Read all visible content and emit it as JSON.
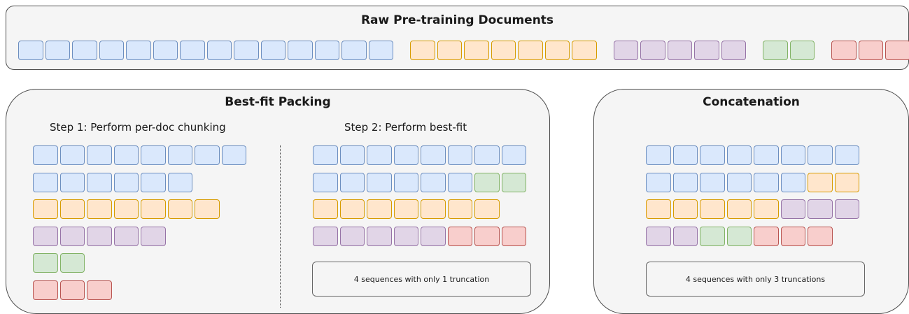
{
  "top": {
    "title": "Raw Pre-training Documents"
  },
  "packing": {
    "title": "Best-fit Packing",
    "step1": "Step 1: Perform per-doc chunking",
    "step2": "Step 2: Perform best-fit",
    "summary": "4 sequences with only 1 truncation"
  },
  "concat": {
    "title": "Concatenation",
    "summary": "4 sequences with only 3 truncations"
  },
  "colors": {
    "blue": {
      "fill": "#dae8fc",
      "stroke": "#6c8ebf"
    },
    "orange": {
      "fill": "#ffe6cc",
      "stroke": "#d79b00"
    },
    "purple": {
      "fill": "#e1d5e7",
      "stroke": "#9673a6"
    },
    "green": {
      "fill": "#d5e8d4",
      "stroke": "#82b366"
    },
    "red": {
      "fill": "#f8cecc",
      "stroke": "#b85450"
    }
  },
  "documents": [
    {
      "color": "blue",
      "blocks": 14
    },
    {
      "color": "orange",
      "blocks": 7
    },
    {
      "color": "purple",
      "blocks": 5
    },
    {
      "color": "green",
      "blocks": 2
    },
    {
      "color": "red",
      "blocks": 3
    }
  ],
  "step1_rows": [
    [
      {
        "color": "blue",
        "n": 8
      }
    ],
    [
      {
        "color": "blue",
        "n": 6
      }
    ],
    [
      {
        "color": "orange",
        "n": 7
      }
    ],
    [
      {
        "color": "purple",
        "n": 5
      }
    ],
    [
      {
        "color": "green",
        "n": 2
      }
    ],
    [
      {
        "color": "red",
        "n": 3
      }
    ]
  ],
  "step2_rows": [
    [
      {
        "color": "blue",
        "n": 8
      }
    ],
    [
      {
        "color": "blue",
        "n": 6
      },
      {
        "color": "green",
        "n": 2
      }
    ],
    [
      {
        "color": "orange",
        "n": 7
      }
    ],
    [
      {
        "color": "purple",
        "n": 5
      },
      {
        "color": "red",
        "n": 3
      }
    ]
  ],
  "concat_rows": [
    [
      {
        "color": "blue",
        "n": 8
      }
    ],
    [
      {
        "color": "blue",
        "n": 6
      },
      {
        "color": "orange",
        "n": 2
      }
    ],
    [
      {
        "color": "orange",
        "n": 5
      },
      {
        "color": "purple",
        "n": 3
      }
    ],
    [
      {
        "color": "purple",
        "n": 2
      },
      {
        "color": "green",
        "n": 2
      },
      {
        "color": "red",
        "n": 3
      }
    ]
  ]
}
